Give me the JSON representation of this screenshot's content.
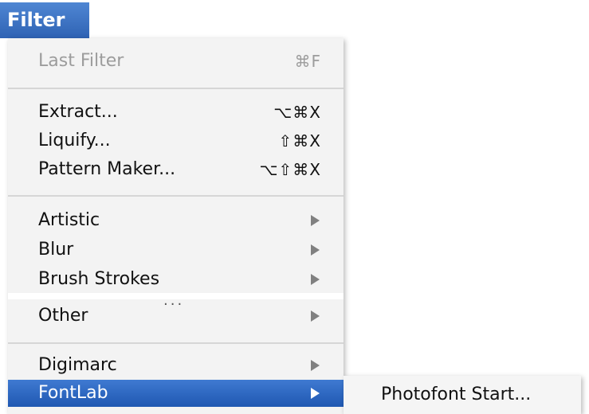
{
  "menu_bar": {
    "title": "Filter"
  },
  "filter_menu": {
    "last_filter": {
      "label": "Last Filter",
      "shortcut": "⌘F"
    },
    "extract": {
      "label": "Extract...",
      "shortcut": "⌥⌘X"
    },
    "liquify": {
      "label": "Liquify...",
      "shortcut": "⇧⌘X"
    },
    "pattern_maker": {
      "label": "Pattern Maker...",
      "shortcut": "⌥⇧⌘X"
    },
    "artistic": {
      "label": "Artistic"
    },
    "blur": {
      "label": "Blur"
    },
    "brush_strokes": {
      "label": "Brush Strokes"
    },
    "ellipsis": "...",
    "other": {
      "label": "Other"
    },
    "digimarc": {
      "label": "Digimarc"
    },
    "fontlab": {
      "label": "FontLab"
    }
  },
  "fontlab_submenu": {
    "items": [
      {
        "label": "Photofont Start..."
      }
    ]
  }
}
